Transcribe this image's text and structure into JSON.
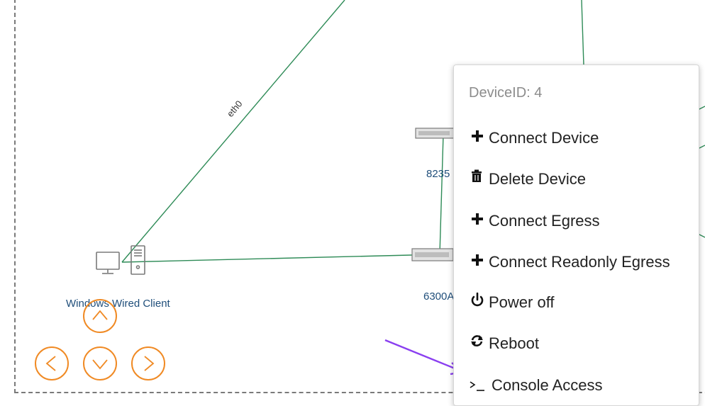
{
  "topology": {
    "link_label": "eth0",
    "nodes": {
      "client_label": "Windows Wired Client",
      "switch_top_label": "8235",
      "switch_bottom_label": "6300A"
    },
    "link_color": "#2e8b57"
  },
  "nav": {
    "up": "up-arrow",
    "left": "left-arrow",
    "down": "down-arrow",
    "right": "right-arrow",
    "color": "#f08a24"
  },
  "context_menu": {
    "title": "DeviceID: 4",
    "items": [
      {
        "label": "Connect Device",
        "icon": "plus-icon"
      },
      {
        "label": "Delete Device",
        "icon": "trash-icon"
      },
      {
        "label": "Connect Egress",
        "icon": "plus-icon"
      },
      {
        "label": "Connect Readonly Egress",
        "icon": "plus-icon"
      },
      {
        "label": "Power off",
        "icon": "power-icon"
      },
      {
        "label": "Reboot",
        "icon": "refresh-icon"
      },
      {
        "label": "Console Access",
        "icon": "terminal-icon"
      }
    ]
  },
  "annotation": {
    "arrow_color": "#8a3ff0"
  }
}
